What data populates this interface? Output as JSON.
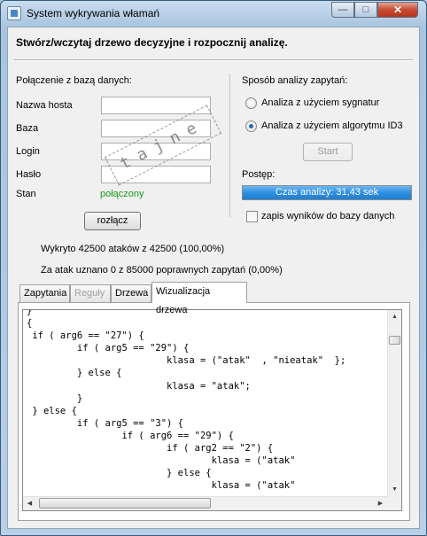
{
  "window": {
    "title": "System wykrywania włamań",
    "min_glyph": "—",
    "max_glyph": "□",
    "close_glyph": "✕"
  },
  "headline": "Stwórz/wczytaj drzewo decyzyjne i rozpocznij analizę.",
  "db": {
    "section_label": "Połączenie z bazą danych:",
    "host_label": "Nazwa hosta",
    "db_label": "Baza",
    "login_label": "Login",
    "password_label": "Hasło",
    "host_value": "",
    "db_value": "",
    "login_value": "",
    "password_value": "",
    "status_label": "Stan",
    "status_value": "połączony",
    "status_color": "#1a9a1a",
    "disconnect_button": "rozłącz"
  },
  "analysis": {
    "section_label": "Sposób analizy zapytań:",
    "option_signatures": "Analiza z użyciem sygnatur",
    "option_id3": "Analiza z użyciem algorytmu ID3",
    "selected": "option_id3",
    "start_button": "Start",
    "progress_label": "Postęp:",
    "progress_text": "Czas analizy: 31,43 sek",
    "progress_fraction": 1.0,
    "save_checkbox_label": "zapis wyników do bazy danych",
    "save_checked": false
  },
  "stats": {
    "detected": "Wykryto 42500 ataków z 42500 (100,00%)",
    "false_positive": "Za atak uznano 0 z 85000 poprawnych zapytań (0,00%)"
  },
  "tabs": [
    {
      "label": "Zapytania",
      "enabled": true
    },
    {
      "label": "Reguły",
      "enabled": false
    },
    {
      "label": "Drzewa",
      "enabled": true
    },
    {
      "label": "Wizualizacja drzewa",
      "enabled": true,
      "selected": true
    }
  ],
  "code_lines": [
    "}",
    "{",
    " if ( arg6 == \"27\") {",
    "         if ( arg5 == \"29\") {",
    "                         klasa = (\"atak\"  , \"nieatak\"  };",
    "         } else {",
    "                         klasa = \"atak\";",
    "         }",
    " } else {",
    "         if ( arg5 == \"3\") {",
    "                 if ( arg6 == \"29\") {",
    "                         if ( arg2 == \"2\") {",
    "                                 klasa = (\"atak\"",
    "                         } else {",
    "                                 klasa = (\"atak\""
  ],
  "watermark_text": "tajne",
  "icons": {
    "app": "app-icon",
    "scroll_up": "scroll-up-arrow-icon",
    "scroll_down": "scroll-down-arrow-icon",
    "scroll_left": "scroll-left-arrow-icon",
    "scroll_right": "scroll-right-arrow-icon"
  }
}
